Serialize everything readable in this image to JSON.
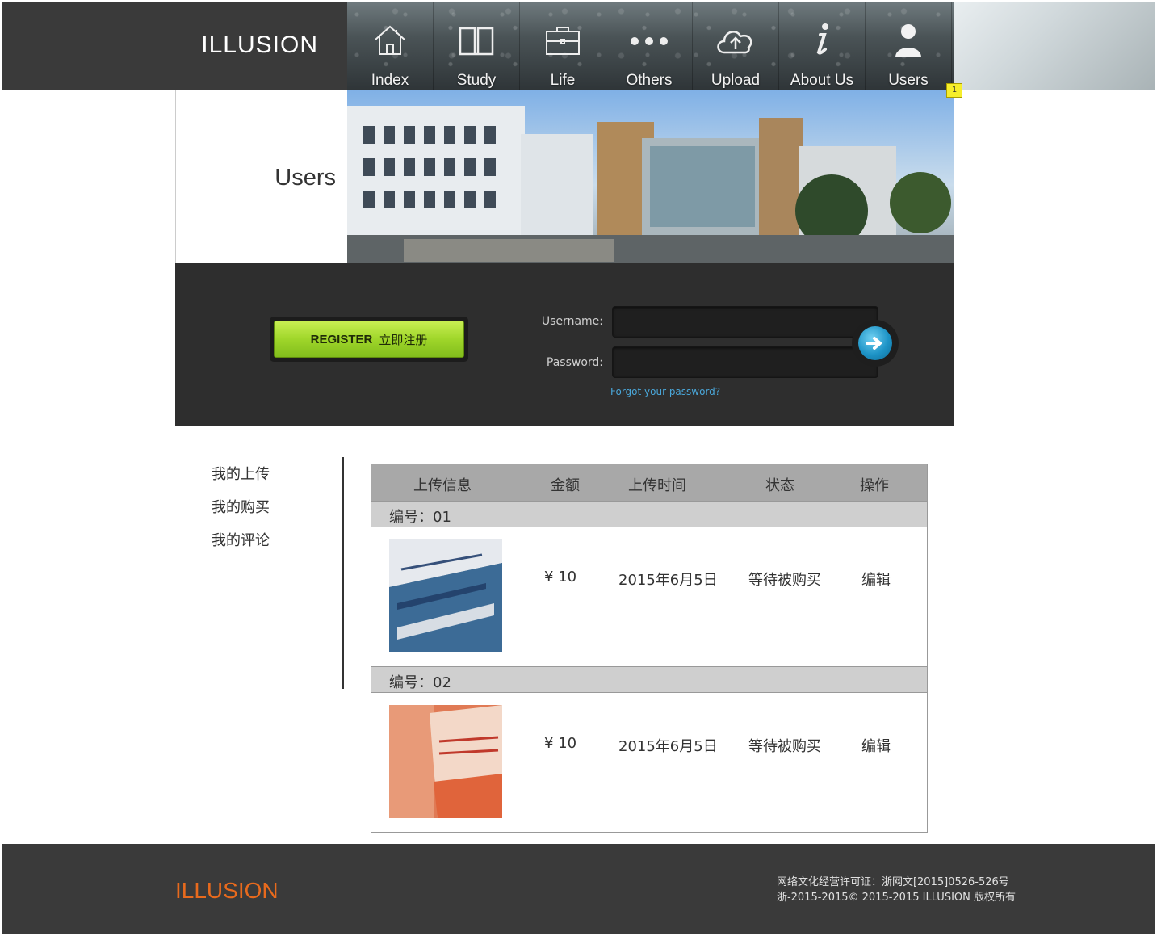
{
  "brand": "ILLUSION",
  "nav": {
    "items": [
      {
        "label": "Index",
        "icon": "home-icon"
      },
      {
        "label": "Study",
        "icon": "book-icon"
      },
      {
        "label": "Life",
        "icon": "briefcase-icon"
      },
      {
        "label": "Others",
        "icon": "more-dots-icon"
      },
      {
        "label": "Upload",
        "icon": "cloud-upload-icon"
      },
      {
        "label": "About Us",
        "icon": "info-icon"
      },
      {
        "label": "Users",
        "icon": "user-icon"
      }
    ],
    "badge": "1"
  },
  "page_title": "Users",
  "login": {
    "register_label": "REGISTER",
    "register_label_cn": "立即注册",
    "username_label": "Username:",
    "password_label": "Password:",
    "forgot_label": "Forgot your password?"
  },
  "sidebar": {
    "items": [
      {
        "label": "我的上传"
      },
      {
        "label": "我的购买"
      },
      {
        "label": "我的评论"
      }
    ]
  },
  "table": {
    "headers": [
      "上传信息",
      "金额",
      "上传时间",
      "状态",
      "操作"
    ],
    "rows": [
      {
        "group": "编号：01",
        "price": "¥ 10",
        "date": "2015年6月5日",
        "status": "等待被购买",
        "action": "编辑",
        "thumb": "book-cover-blue"
      },
      {
        "group": "编号：02",
        "price": "¥ 10",
        "date": "2015年6月5日",
        "status": "等待被购买",
        "action": "编辑",
        "thumb": "book-cover-orange"
      }
    ]
  },
  "footer": {
    "brand": "ILLUSION",
    "license": "网络文化经营许可证：浙网文[2015]0526-526号",
    "copyright": "浙-2015-2015© 2015-2015 ILLUSION 版权所有"
  },
  "colors": {
    "header_bg": "#3a3a3a",
    "footer_brand": "#e86a1d",
    "register_green": "#9fd62a",
    "go_button_blue": "#1d93c6",
    "forgot_link": "#4aa6d8"
  }
}
